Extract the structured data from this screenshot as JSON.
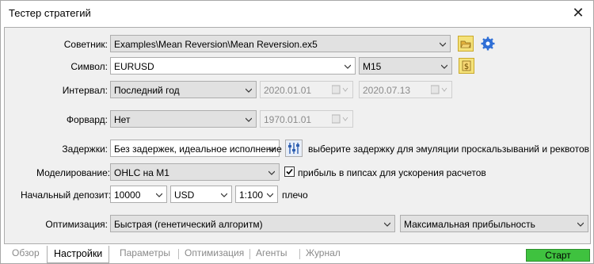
{
  "window": {
    "title": "Тестер стратегий"
  },
  "expert": {
    "label": "Советник:",
    "value": "Examples\\Mean Reversion\\Mean Reversion.ex5"
  },
  "symbol": {
    "label": "Символ:",
    "value": "EURUSD",
    "timeframe": "M15"
  },
  "interval": {
    "label": "Интервал:",
    "value": "Последний год",
    "from": "2020.01.01",
    "to": "2020.07.13"
  },
  "forward": {
    "label": "Форвард:",
    "value": "Нет",
    "date": "1970.01.01"
  },
  "delays": {
    "label": "Задержки:",
    "value": "Без задержек, идеальное исполнение",
    "hint": "выберите задержку для эмуляции проскальзываний и реквотов"
  },
  "modeling": {
    "label": "Моделирование:",
    "value": "OHLC на M1",
    "pips_checkbox_label": "прибыль в пипсах для ускорения расчетов",
    "pips_checked": true
  },
  "deposit": {
    "label": "Начальный депозит:",
    "amount": "10000",
    "currency": "USD",
    "leverage": "1:100",
    "leverage_label": "плечо"
  },
  "optimization": {
    "label": "Оптимизация:",
    "value": "Быстрая (генетический алгоритм)",
    "criterion": "Максимальная прибыльность"
  },
  "tabs": [
    {
      "label": "Обзор",
      "active": false
    },
    {
      "label": "Настройки",
      "active": true
    },
    {
      "label": "Параметры",
      "active": false
    },
    {
      "label": "Оптимизация",
      "active": false
    },
    {
      "label": "Агенты",
      "active": false
    },
    {
      "label": "Журнал",
      "active": false
    }
  ],
  "start_button": {
    "label": "Старт",
    "color": "#3fc23f"
  },
  "icons": {
    "expert_open": "open-folder-icon",
    "expert_settings": "gear-icon",
    "symbol_props": "dollar-icon",
    "delays": "sliders-icon",
    "close": "close-icon"
  }
}
